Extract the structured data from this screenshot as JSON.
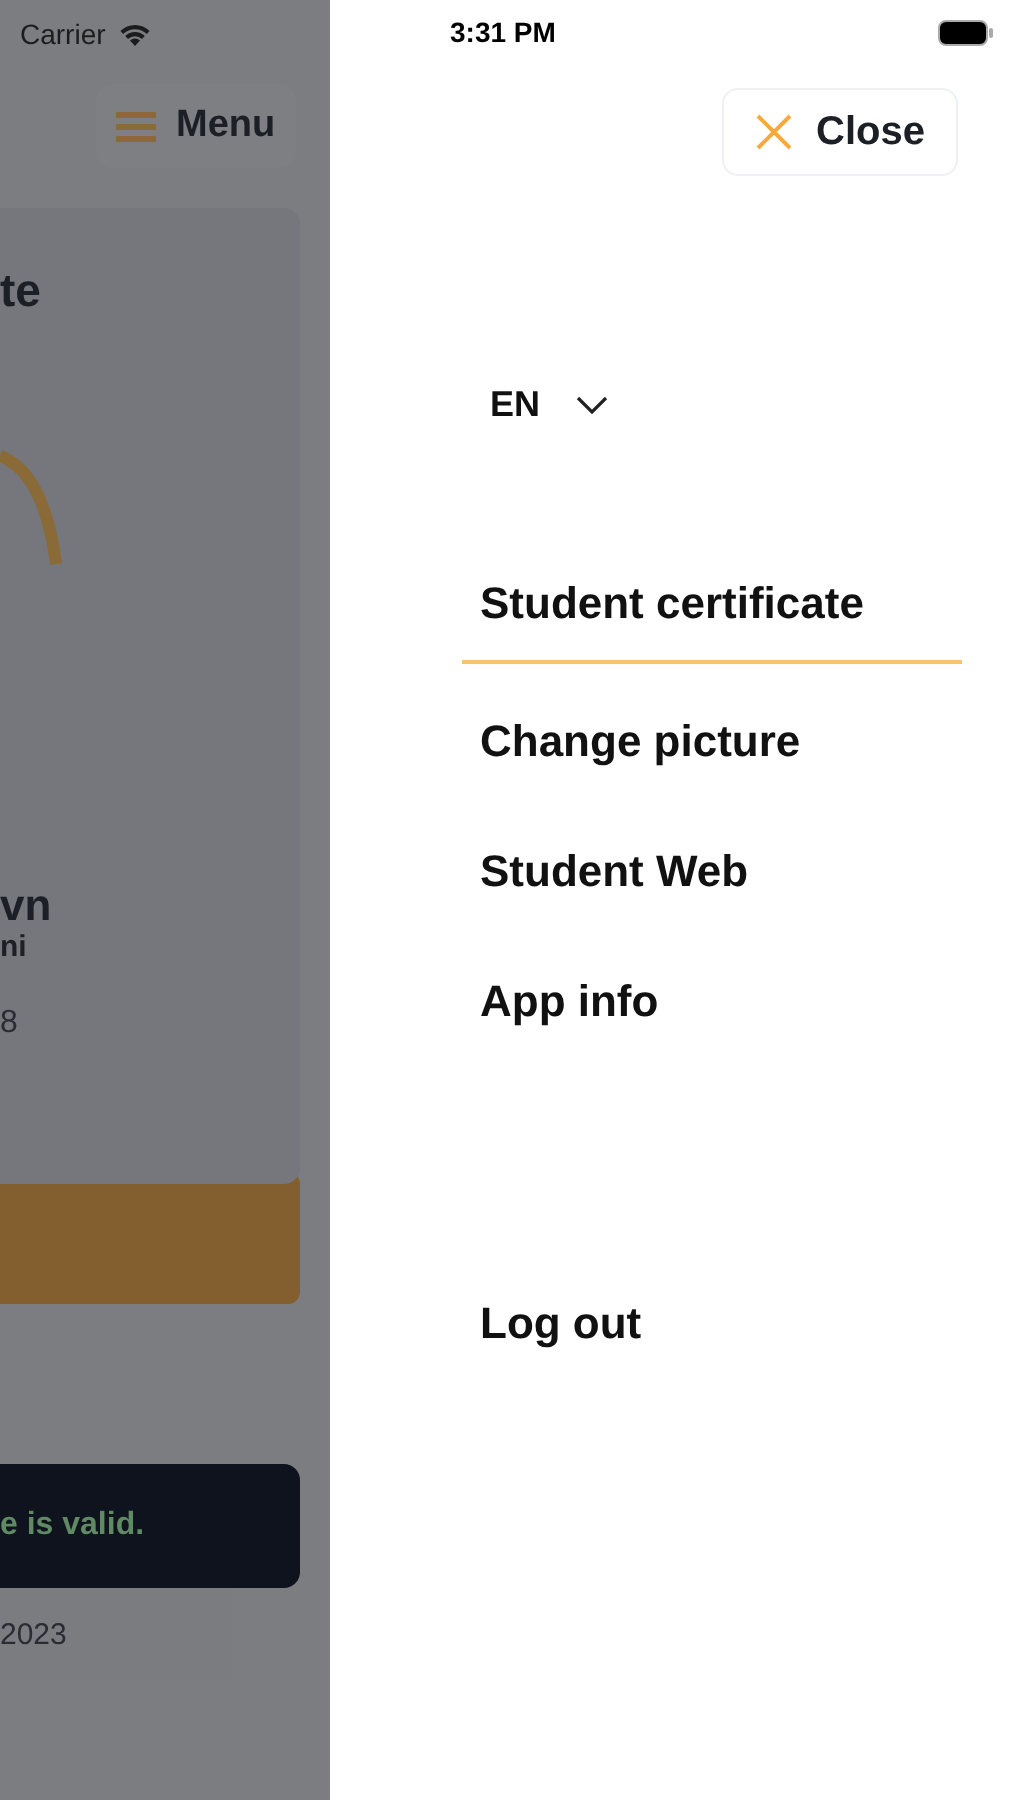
{
  "status_bar": {
    "carrier": "Carrier",
    "time": "3:31 PM"
  },
  "background_page": {
    "menu_button": "Menu",
    "card_title": "te",
    "name": "vn",
    "name_second_line": "ni",
    "detail": "8",
    "valid_message": "e is valid.",
    "date": "2023"
  },
  "close_button": "Close",
  "language": "EN",
  "menu_items": [
    {
      "label": "Student certificate",
      "selected": true
    },
    {
      "label": "Change picture",
      "selected": false
    },
    {
      "label": "Student Web",
      "selected": false
    },
    {
      "label": "App info",
      "selected": false
    }
  ],
  "log_out": "Log out"
}
